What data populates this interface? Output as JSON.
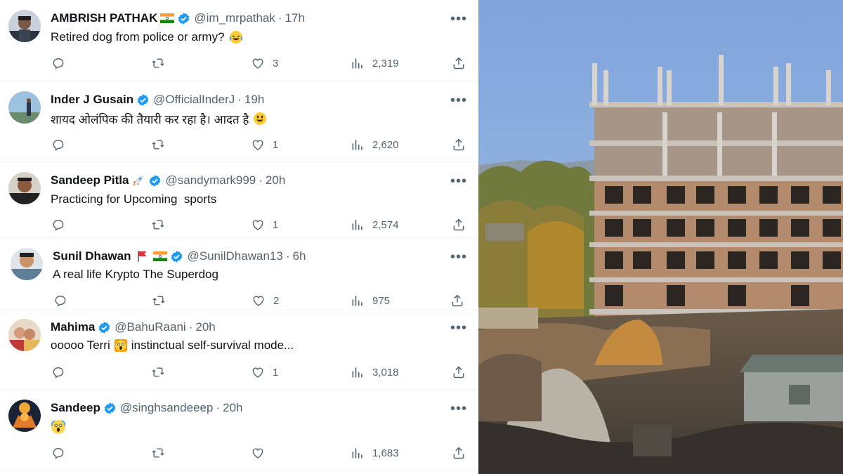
{
  "tweets": [
    {
      "name": "AMBRISH PATHAK",
      "name_emoji": "india-flag",
      "verified": true,
      "handle": "@im_mrpathak",
      "time": "17h",
      "text": "Retired dog from police or army?",
      "text_emoji": "laughing-tears",
      "replies": "",
      "reposts": "",
      "likes": "3",
      "views": "2,319"
    },
    {
      "name": "Inder J Gusain",
      "verified": true,
      "handle": "@OfficialInderJ",
      "time": "19h",
      "text": "शायद ओलंपिक की तैयारी कर रहा है। आदत है",
      "text_emoji": "grinning-face",
      "replies": "",
      "reposts": "",
      "likes": "1",
      "views": "2,620"
    },
    {
      "name": "Sandeep Pitla",
      "name_emoji": "rocket",
      "verified": true,
      "handle": "@sandymark999",
      "time": "20h",
      "text": "Practicing for Upcoming  sports",
      "replies": "",
      "reposts": "",
      "likes": "1",
      "views": "2,574"
    },
    {
      "name": "Sunil Dhawan",
      "name_emoji": "red-flag india-flag",
      "verified": true,
      "handle": "@SunilDhawan13",
      "time": "6h",
      "text": "A real life Krypto The Superdog",
      "replies": "",
      "reposts": "",
      "likes": "2",
      "views": "975"
    },
    {
      "name": "Mahima",
      "verified": true,
      "handle": "@BahuRaani",
      "time": "20h",
      "text_before": "ooooo Terri",
      "text_emoji": "screaming-face",
      "text_after": "instinctual self-survival mode...",
      "replies": "",
      "reposts": "",
      "likes": "1",
      "views": "3,018"
    },
    {
      "name": "Sandeep",
      "verified": true,
      "handle": "@singhsandeeep",
      "time": "20h",
      "text": "",
      "text_emoji": "screaming-face",
      "replies": "",
      "reposts": "",
      "likes": "",
      "views": "1,683"
    }
  ],
  "ui": {
    "separator": "·",
    "more_icon": "more-horizontal-icon",
    "reply_icon": "reply-icon",
    "repost_icon": "repost-icon",
    "like_icon": "heart-icon",
    "views_icon": "views-chart-icon",
    "share_icon": "share-icon"
  },
  "colors": {
    "text": "#0f1419",
    "muted": "#536471",
    "verified": "#1d9bf0",
    "divider": "#eff3f4"
  },
  "media": {
    "description_icon": "video-frame-construction-site"
  }
}
